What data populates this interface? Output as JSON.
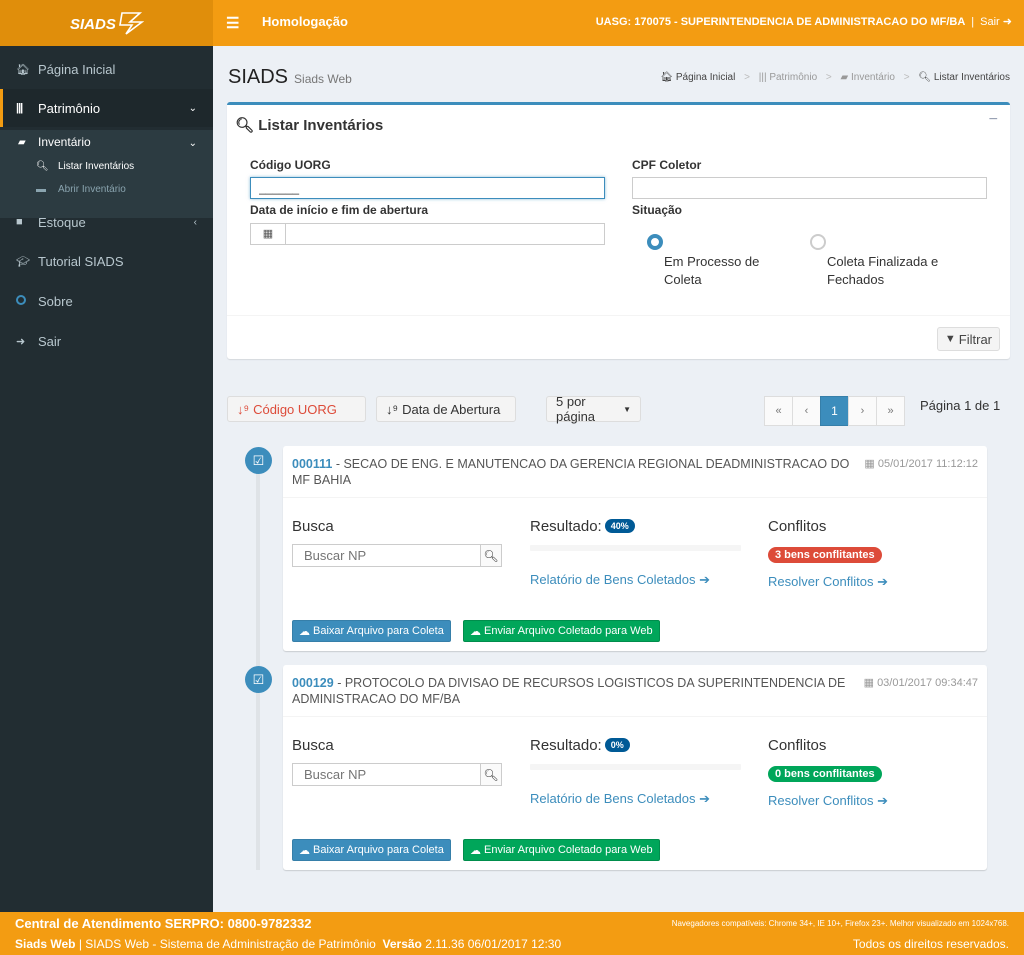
{
  "header": {
    "logo_text": "SIADS",
    "menu_icon": "☰",
    "environment": "Homologação",
    "uasg": "UASG: 170075 - SUPERINTENDENCIA DE ADMINISTRACAO DO MF/BA",
    "separator": "|",
    "exit": "Sair"
  },
  "sidebar": {
    "items": [
      {
        "label": "Página Inicial",
        "icon": "home-icon"
      },
      {
        "label": "Patrimônio",
        "icon": "barcode-icon"
      },
      {
        "label": "Estoque",
        "icon": "archive-icon"
      },
      {
        "label": "Tutorial SIADS",
        "icon": "graduation-cap-icon"
      },
      {
        "label": "Sobre",
        "icon": "circle-icon"
      },
      {
        "label": "Sair",
        "icon": "sign-out-icon"
      }
    ],
    "submenu": {
      "label": "Inventário",
      "children": [
        {
          "label": "Listar Inventários"
        },
        {
          "label": "Abrir Inventário"
        }
      ]
    }
  },
  "content_header": {
    "title": "SIADS",
    "subtitle": "Siads Web"
  },
  "breadcrumb": [
    "Página Inicial",
    "Patrimônio",
    "Inventário",
    "Listar Inventários"
  ],
  "filter": {
    "title": "Listar Inventários",
    "collapse": "−",
    "codigo_uorg_label": "Código UORG",
    "codigo_uorg_value": "______",
    "cpf_label": "CPF Coletor",
    "cpf_value": "",
    "date_label": "Data de início e fim de abertura",
    "date_value": "",
    "situacao_label": "Situação",
    "radio_1": "Em Processo de Coleta",
    "radio_2": "Coleta Finalizada e Fechados",
    "filter_button": "Filtrar"
  },
  "toolbar": {
    "sort_uorg": "Código UORG",
    "sort_date": "Data de Abertura",
    "page_size": "5 por página",
    "pager": [
      "«",
      "‹",
      "1",
      "›",
      "»"
    ],
    "page_info": "Página 1 de 1"
  },
  "labels": {
    "busca": "Busca",
    "resultado": "Resultado:",
    "conflitos": "Conflitos",
    "search_placeholder": "Buscar NP",
    "report_link": "Relatório de Bens Coletados",
    "resolve_link": "Resolver Conflitos",
    "download_button": "Baixar Arquivo para Coleta",
    "upload_button": "Enviar Arquivo Coletado para Web"
  },
  "inventories": [
    {
      "code": "000111",
      "name": "SECAO DE ENG. E MANUTENCAO DA GERENCIA REGIONAL DEADMINISTRACAO DO MF BAHIA",
      "date": "05/01/2017 11:12:12",
      "result_pct": "40%",
      "result_value": 0,
      "conflicts": "3 bens conflitantes",
      "conflict_color": "#dd4b39"
    },
    {
      "code": "000129",
      "name": "PROTOCOLO DA DIVISAO DE RECURSOS LOGISTICOS DA SUPERINTENDENCIA DE ADMINISTRACAO DO MF/BA",
      "date": "03/01/2017 09:34:47",
      "result_pct": "0%",
      "result_value": 0,
      "conflicts": "0 bens conflitantes",
      "conflict_color": "#00a65a"
    }
  ],
  "footer": {
    "central": "Central de Atendimento SERPRO: 0800-9782332",
    "browsers": "Navegadores compatíveis: Chrome 34+, IE 10+, Firefox 23+. Melhor visualizado em 1024x768.",
    "app_name": "Siads Web",
    "app_desc": "| SIADS Web - Sistema de Administração de Patrimônio",
    "version_label": "Versão",
    "version_value": "2.11.36 06/01/2017 12:30",
    "rights": "Todos os direitos reservados."
  },
  "colors": {
    "primary": "#3c8dbc",
    "header": "#f39c12",
    "sidebar": "#222d32",
    "success": "#00a65a",
    "danger": "#dd4b39"
  }
}
